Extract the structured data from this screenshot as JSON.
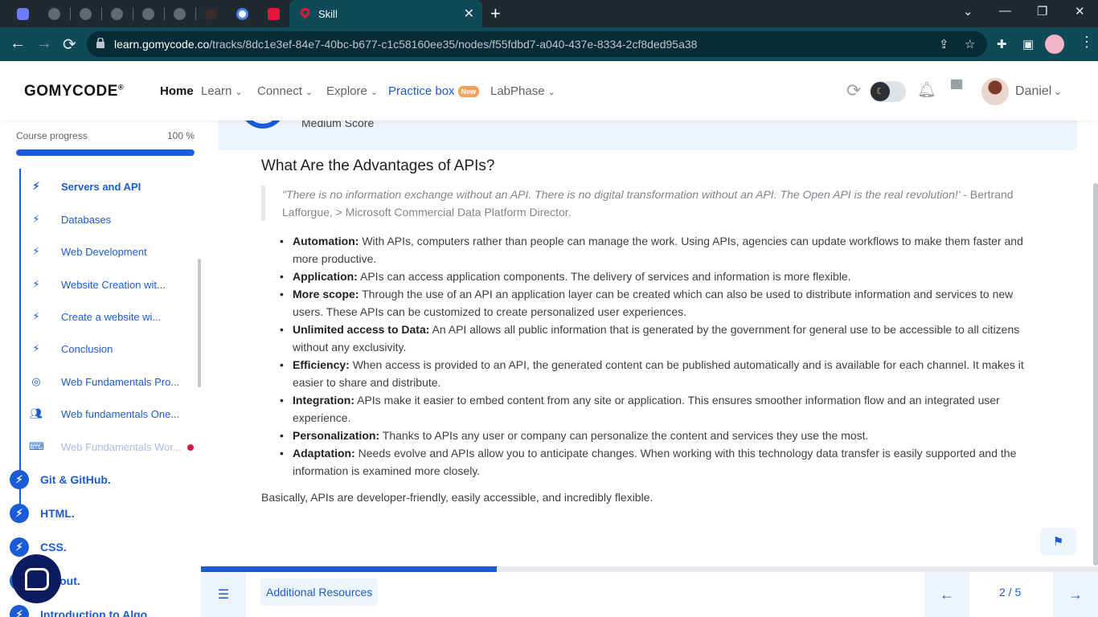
{
  "browser": {
    "active_tab_title": "Skill",
    "close_symbol": "✕",
    "new_tab_symbol": "+",
    "url_domain": "learn.gomycode.co",
    "url_path": "/tracks/8dc1e3ef-84e7-40bc-b677-c1c58160ee35/nodes/f55fdbd7-a040-437e-8334-2cf8ded95a38",
    "back_symbol": "←",
    "forward_symbol": "→",
    "reload_symbol": "⟳",
    "min_symbol": "—",
    "max_symbol": "❐",
    "win_close_symbol": "✕",
    "dropdown_symbol": "⌄"
  },
  "header": {
    "logo_text": "GOMYCODE",
    "logo_mark": "®",
    "nav": {
      "home": "Home",
      "learn": "Learn",
      "connect": "Connect",
      "explore": "Explore",
      "practice_box": "Practice box",
      "practice_badge": "New",
      "labphase": "LabPhase"
    },
    "chevron": "⌄",
    "username": "Daniel"
  },
  "sidebar": {
    "progress_label": "Course progress",
    "progress_percent_text": "100 %",
    "progress_fraction": 1.0,
    "items": [
      {
        "label": "Servers and API",
        "icon": "lightning-icon"
      },
      {
        "label": "Databases",
        "icon": "lightning-icon"
      },
      {
        "label": "Web Development",
        "icon": "lightning-icon"
      },
      {
        "label": "Website Creation wit...",
        "icon": "lightning-icon"
      },
      {
        "label": "Create a website wi...",
        "icon": "lightning-icon"
      },
      {
        "label": "Conclusion",
        "icon": "lightning-icon"
      },
      {
        "label": "Web Fundamentals Pro...",
        "icon": "target-icon"
      },
      {
        "label": "Web fundamentals One...",
        "icon": "people-icon"
      },
      {
        "label": "Web Fundamentals Wor...",
        "icon": "workshop-icon"
      }
    ],
    "chapters": [
      {
        "label": "Git & GitHub."
      },
      {
        "label": "HTML."
      },
      {
        "label": "CSS."
      },
      {
        "label": "Layout."
      },
      {
        "label": "Introduction to Algo..."
      }
    ]
  },
  "main": {
    "score_label": "Medium Score",
    "title": "What Are the Advantages of APIs?",
    "quote_italic": "\"There is no information exchange without an API. There is no digital transformation without an API. The Open API is the real revolution!'",
    "quote_author": " - Bertrand Lafforgue, > Microsoft Commercial Data Platform Director.",
    "bullets": [
      {
        "term": "Automation:",
        "text": " With APIs, computers rather than people can manage the work. Using APIs, agencies can update workflows to make them faster and more productive."
      },
      {
        "term": "Application:",
        "text": " APIs can access application components. The delivery of services and information is more flexible."
      },
      {
        "term": "More scope:",
        "text": " Through the use of an API an application layer can be created which can also be used to distribute information and services to new users. These APIs can be customized to create personalized user experiences."
      },
      {
        "term": "Unlimited access to Data:",
        "text": " An API allows all public information that is generated by the government for general use to be accessible to all citizens without any exclusivity."
      },
      {
        "term": "Efficiency:",
        "text": " When access is provided to an API, the generated content can be published automatically and is available for each channel. It makes it easier to share and distribute."
      },
      {
        "term": "Integration:",
        "text": " APIs make it easier to embed content from any site or application. This ensures smoother information flow and an integrated user experience."
      },
      {
        "term": "Personalization:",
        "text": " Thanks to APIs any user or company can personalize the content and services they use the most."
      },
      {
        "term": "Adaptation:",
        "text": " Needs evolve and APIs allow you to anticipate changes. When working with this technology data transfer is easily supported and the information is examined more closely."
      }
    ],
    "summary": "Basically, APIs are developer-friendly, easily accessible, and incredibly flexible."
  },
  "bottom": {
    "additional_resources": "Additional Resources",
    "page_indicator": "2 / 5",
    "lesson_progress_fraction": 0.33,
    "prev_symbol": "←",
    "next_symbol": "→"
  },
  "colors": {
    "accent": "#1a5cd7",
    "tab_bar": "#1f2a30",
    "toolbar": "#0f4a58",
    "badge": "#f5a15b",
    "alert_dot": "#e8143a"
  }
}
